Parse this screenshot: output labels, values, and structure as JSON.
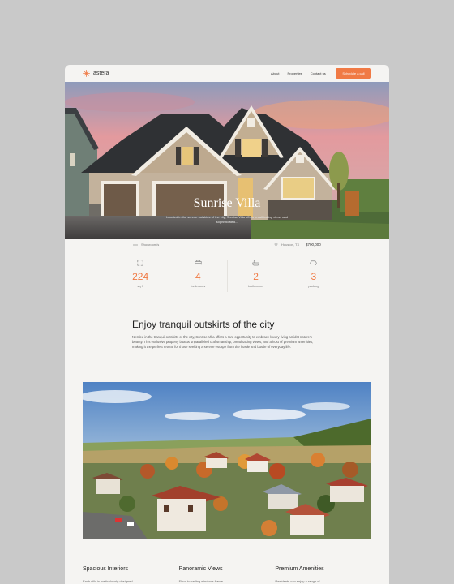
{
  "brand": {
    "name": "astera",
    "accent": "#f07a45"
  },
  "nav": {
    "links": [
      "About",
      "Properties",
      "Contact us"
    ],
    "cta": "Schedule a call"
  },
  "hero": {
    "title": "Sunrise Villa",
    "subtitle": "Located in the serene outskirts of the city, Sunrise Villa offers breathtaking views and sophisticated..."
  },
  "meta": {
    "left_label": "Showroom/s",
    "location": "Houston, TX",
    "price": "$700,000"
  },
  "stats": [
    {
      "icon": "area-icon",
      "value": "224",
      "label": "sq ft"
    },
    {
      "icon": "bed-icon",
      "value": "4",
      "label": "bedrooms"
    },
    {
      "icon": "bath-icon",
      "value": "2",
      "label": "bathrooms"
    },
    {
      "icon": "car-icon",
      "value": "3",
      "label": "parking"
    }
  ],
  "about": {
    "title": "Enjoy tranquil outskirts of the city",
    "text": "Nestled in the tranquil outskirts of the city, Sunrise Villa offers a rare opportunity to embrace luxury living amidst nature's beauty. This exclusive property boasts unparalleled craftsmanship, breathtaking views, and a host of premium amenities, making it the perfect retreat for those seeking a serene escape from the hustle and bustle of everyday life."
  },
  "features": [
    {
      "title": "Spacious Interiors",
      "text": "Each villa is meticulously designed"
    },
    {
      "title": "Panoramic Views",
      "text": "Floor-to-ceiling windows frame"
    },
    {
      "title": "Premium Amenities",
      "text": "Residents can enjoy a range of"
    }
  ]
}
